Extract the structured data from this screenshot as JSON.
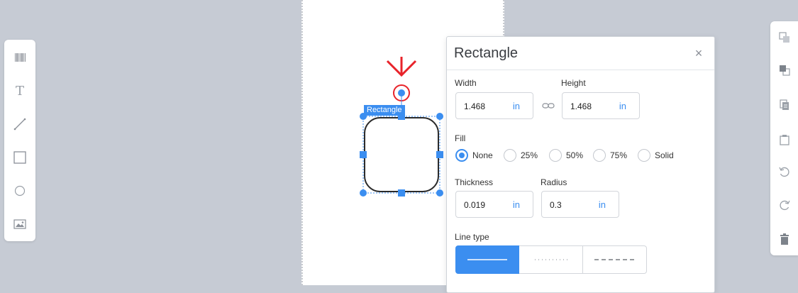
{
  "left_toolbar": {
    "tools": [
      {
        "name": "barcode-icon"
      },
      {
        "name": "text-icon",
        "glyph": "T"
      },
      {
        "name": "line-icon"
      },
      {
        "name": "rectangle-icon"
      },
      {
        "name": "ellipse-icon"
      },
      {
        "name": "image-icon"
      }
    ]
  },
  "right_toolbar": {
    "tools": [
      {
        "name": "send-to-back-icon"
      },
      {
        "name": "bring-to-front-icon"
      },
      {
        "name": "copy-icon"
      },
      {
        "name": "paste-icon"
      },
      {
        "name": "undo-icon"
      },
      {
        "name": "redo-icon"
      },
      {
        "name": "delete-icon"
      }
    ]
  },
  "canvas": {
    "shape_label": "Rectangle",
    "annotation_color": "#e8232a",
    "selection_color": "#3b8ef0"
  },
  "panel": {
    "title": "Rectangle",
    "close_glyph": "×",
    "width_label": "Width",
    "width_value": "1.468",
    "width_unit": "in",
    "height_label": "Height",
    "height_value": "1.468",
    "height_unit": "in",
    "fill_label": "Fill",
    "fill_options": [
      "None",
      "25%",
      "50%",
      "75%",
      "Solid"
    ],
    "fill_selected": "None",
    "thickness_label": "Thickness",
    "thickness_value": "0.019",
    "thickness_unit": "in",
    "radius_label": "Radius",
    "radius_value": "0.3",
    "radius_unit": "in",
    "line_type_label": "Line type",
    "line_types": [
      "solid",
      "dotted",
      "dashed"
    ],
    "line_type_selected": "solid"
  },
  "colors": {
    "accent": "#3b8ef0",
    "background": "#c6cbd4"
  }
}
